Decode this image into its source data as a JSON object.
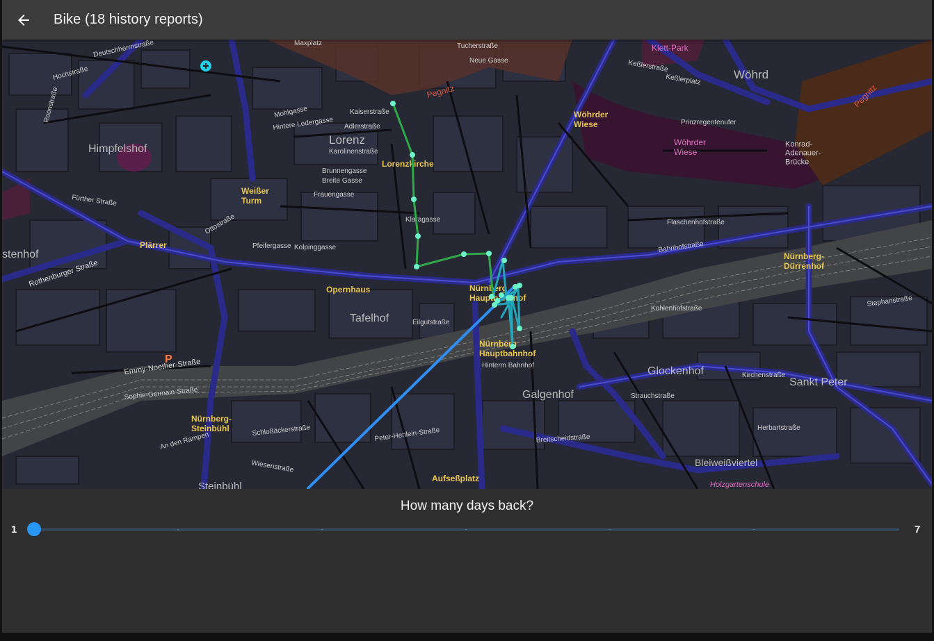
{
  "appbar": {
    "back_icon": "arrow-left-icon",
    "title": "Bike (18 history reports)"
  },
  "map": {
    "labels": {
      "deutschherrnstrasse": "Deutschherrnstraße",
      "maxplatz": "Maxplatz",
      "tucherstrasse": "Tucherstraße",
      "neue_gasse": "Neue Gasse",
      "klettpark": "Klett-Park",
      "kesslerstrasse": "Keßlerstraße",
      "kesslerplatz": "Keßlerplatz",
      "woehrd": "Wöhrd",
      "pegnitz": "Pegnitz",
      "pegnitz_east": "Pegnitz",
      "hochstrasse": "Hochstraße",
      "roonstrasse": "Roonstraße",
      "mohlgasse": "Mohlgasse",
      "kaiserstrasse": "Kaiserstraße",
      "hintere_ledergasse": "Hintere Ledergasse",
      "adlerstrasse": "Adlerstraße",
      "lorenz": "Lorenz",
      "karolinenstrasse": "Karolinenstraße",
      "himpfelshof": "Himpfelshof",
      "lorenzkirche": "Lorenzkirche",
      "woehrder_wiese": "Wöhrder\nWiese",
      "woehrder_wiese_park": "Wöhrder\nWiese",
      "prinzregentenufer": "Prinzregentenufer",
      "konrad_adenauer": "Konrad-\nAdenauer-\nBrücke",
      "brunnengasse": "Brunnengasse",
      "breite_gasse": "Breite Gasse",
      "weisser_turm": "Weißer\nTurm",
      "frauengasse": "Frauengasse",
      "fuerther_strasse": "Fürther Straße",
      "plaerrer": "Plärrer",
      "stenhof": "stenhof",
      "ottostrasse": "Ottostraße",
      "pfeifergasse": "Pfeifergasse",
      "kolpinggasse": "Kolpinggasse",
      "klaragasse": "Klaragasse",
      "flaschenhofstrasse": "Flaschenhofstraße",
      "bahnhofstrasse": "Bahnhofstraße",
      "nuernberg_duerrenhof": "Nürnberg-\nDürrenhof",
      "rothenburger_strasse": "Rothenburger Straße",
      "opernhaus": "Opernhaus",
      "tafelhof": "Tafelhof",
      "nuernberg_hbf_top": "Nürnberg\nHauptbahnhof",
      "nuernberg_hbf": "Nürnberg\nHauptbahnhof",
      "hinterm_bahnhof": "Hinterm Bahnhof",
      "eilgutstrasse": "Eilgutstraße",
      "kohlenhofstrasse": "Kohlenhofstraße",
      "stephanstrasse": "Stephanstraße",
      "emmy_noether": "Emmy-Noether-Straße",
      "sophie_germain": "Sophie-Germain-Straße",
      "glockenhof": "Glockenhof",
      "kirchenstrasse": "Kirchenstraße",
      "sankt_peter": "Sankt Peter",
      "galgenhof": "Galgenhof",
      "nuernberg_steinbuehl": "Nürnberg-\nSteinbühl",
      "an_den_rampen": "An den Rampen",
      "schlossaeckerstrasse": "Schloßäckerstraße",
      "peter_henlein": "Peter-Henlein-Straße",
      "strauchstrasse": "Strauchstraße",
      "breitscheidstrasse": "Breitscheidstraße",
      "herbartstrasse": "Herbartstraße",
      "bleiweissviertel": "Bleiweißviertel",
      "aufsessplatz": "Aufseßplatz",
      "holzgartenschule": "Holzgartenschule",
      "steinbuehl": "Steinbühl",
      "wiesenstrasse": "Wiesenstraße",
      "parking": "P"
    },
    "colors": {
      "track_green": "#2fa84a",
      "track_teal": "#22a6b8",
      "track_blue": "#2f8ef2",
      "point": "#6cf2c8"
    }
  },
  "controls": {
    "question": "How many days back?",
    "slider": {
      "min_label": "1",
      "max_label": "7",
      "min": 1,
      "max": 7,
      "value": 1
    }
  }
}
